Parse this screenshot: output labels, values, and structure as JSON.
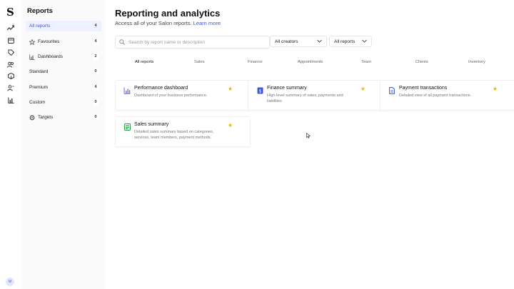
{
  "app": {
    "logo_letter": "S",
    "avatar_initials": "M"
  },
  "colors": {
    "accent": "#3d55d6",
    "star": "#f2b400",
    "active_bg": "#eef1ff"
  },
  "rail": {
    "icons": [
      "trend-icon",
      "calendar-icon",
      "tag-icon",
      "users-icon",
      "box-icon",
      "person-icon",
      "bar-chart-icon"
    ]
  },
  "sidebar": {
    "title": "Reports",
    "items": [
      {
        "label": "All reports",
        "count": "4",
        "icon": "",
        "active": true
      },
      {
        "label": "Favourites",
        "count": "4",
        "icon": "star-icon",
        "active": false
      },
      {
        "label": "Dashboards",
        "count": "2",
        "icon": "chart-icon",
        "active": false
      },
      {
        "label": "Standard",
        "count": "0",
        "icon": "",
        "active": false
      },
      {
        "label": "Premium",
        "count": "4",
        "icon": "",
        "active": false
      },
      {
        "label": "Custom",
        "count": "0",
        "icon": "",
        "active": false
      },
      {
        "label": "Targets",
        "count": "0",
        "icon": "target-icon",
        "active": false
      }
    ]
  },
  "main": {
    "title": "Reporting and analytics",
    "subtitle": "Access all of your Salon reports.",
    "learn_more": "Learn more",
    "search_placeholder": "Search by report name or description",
    "filter_creators": "All creators",
    "filter_reports": "All reports",
    "tabs": [
      "All reports",
      "Sales",
      "Finance",
      "Appointments",
      "Team",
      "Clients",
      "Inventory"
    ],
    "active_tab": "All reports",
    "cards": [
      {
        "title": "Performance dashboard",
        "desc": "Dashboard of your business performance.",
        "icon": "dashboard-chart-icon",
        "icon_color": "#7b6bd6",
        "favourite": true
      },
      {
        "title": "Finance summary",
        "desc": "High-level summary of sales, payments and liabilities",
        "icon": "finance-doc-icon",
        "icon_color": "#3d55d6",
        "favourite": true
      },
      {
        "title": "Payment transactions",
        "desc": "Detailed view of all payment transactions.",
        "icon": "document-icon",
        "icon_color": "#3d55d6",
        "favourite": true
      },
      {
        "title": "Sales summary",
        "desc": "Detailed sales summary based on categories, services, team members, payment methods.",
        "icon": "sales-doc-icon",
        "icon_color": "#2e9a4a",
        "favourite": true
      }
    ]
  }
}
